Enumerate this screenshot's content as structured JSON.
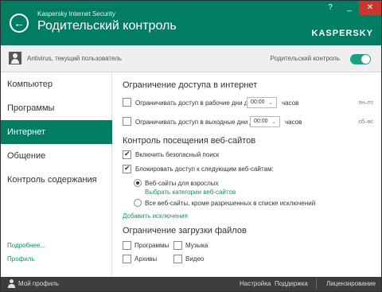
{
  "header": {
    "app_name": "Kaspersky Internet Security",
    "title": "Родительский контроль",
    "brand": "KASPERSKY",
    "help_label": "?",
    "min_label": "_",
    "close_label": "✕"
  },
  "userbar": {
    "user": "Antivirus, текущий пользователь",
    "pc_label": "Родительский контроль",
    "toggle_on": true
  },
  "sidebar": {
    "items": [
      {
        "label": "Компьютер"
      },
      {
        "label": "Программы"
      },
      {
        "label": "Интернет"
      },
      {
        "label": "Общение"
      },
      {
        "label": "Контроль содержания"
      }
    ],
    "more_link": "Подробнее...",
    "profile_link": "Профиль"
  },
  "internet_access": {
    "title": "Ограничение доступа в интернет",
    "weekdays_label": "Ограничивать доступ в рабочие дни до",
    "weekdays_value": "00:00",
    "weekdays_unit": "часов",
    "weekdays_days": "пн–пт",
    "weekend_label": "Ограничивать доступ в выходные дни до",
    "weekend_value": "00:00",
    "weekend_unit": "часов",
    "weekend_days": "сб–вс"
  },
  "web_control": {
    "title": "Контроль посещения веб-сайтов",
    "safe_search": "Включить безопасный поиск",
    "block_label": "Блокировать доступ к следующим веб-сайтам:",
    "adult_sites": "Веб-сайты для взрослых",
    "choose_categories": "Выбрать категории веб-сайтов",
    "all_except": "Все веб-сайты, кроме разрешенных в списке исключений",
    "add_exceptions": "Добавить исключения"
  },
  "downloads": {
    "title": "Ограничение загрузки файлов",
    "programs": "Программы",
    "music": "Музыка",
    "archives": "Архивы",
    "video": "Видео"
  },
  "footer": {
    "profile": "Мой профиль",
    "settings": "Настройка",
    "support": "Поддержка",
    "licensing": "Лицензирование"
  }
}
